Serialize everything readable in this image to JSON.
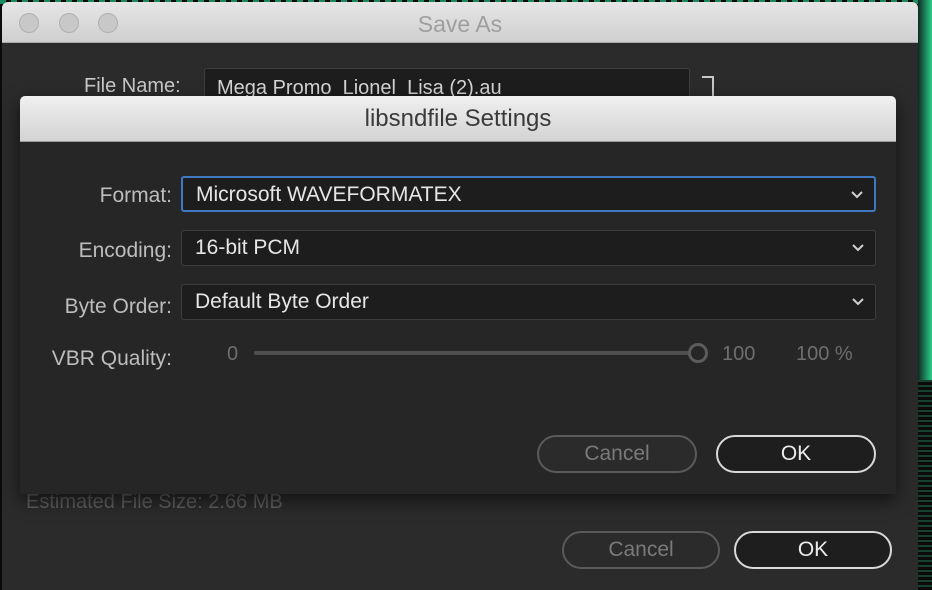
{
  "save_as": {
    "title": "Save As",
    "file_name_label": "File Name:",
    "file_name_value": "Mega Promo_Lionel_Lisa (2).au",
    "estimated_size": "Estimated File Size: 2.66 MB",
    "cancel_label": "Cancel",
    "ok_label": "OK"
  },
  "libsndfile": {
    "title": "libsndfile Settings",
    "format": {
      "label": "Format:",
      "value": "Microsoft WAVEFORMATEX"
    },
    "encoding": {
      "label": "Encoding:",
      "value": "16-bit PCM"
    },
    "byte_order": {
      "label": "Byte Order:",
      "value": "Default Byte Order"
    },
    "vbr": {
      "label": "VBR Quality:",
      "min": "0",
      "max": "100",
      "value_text": "100 %",
      "level": 1.0
    },
    "cancel_label": "Cancel",
    "ok_label": "OK"
  },
  "colors": {
    "accent_focus": "#3f79c4",
    "background_waveform": "#2bd08a"
  }
}
